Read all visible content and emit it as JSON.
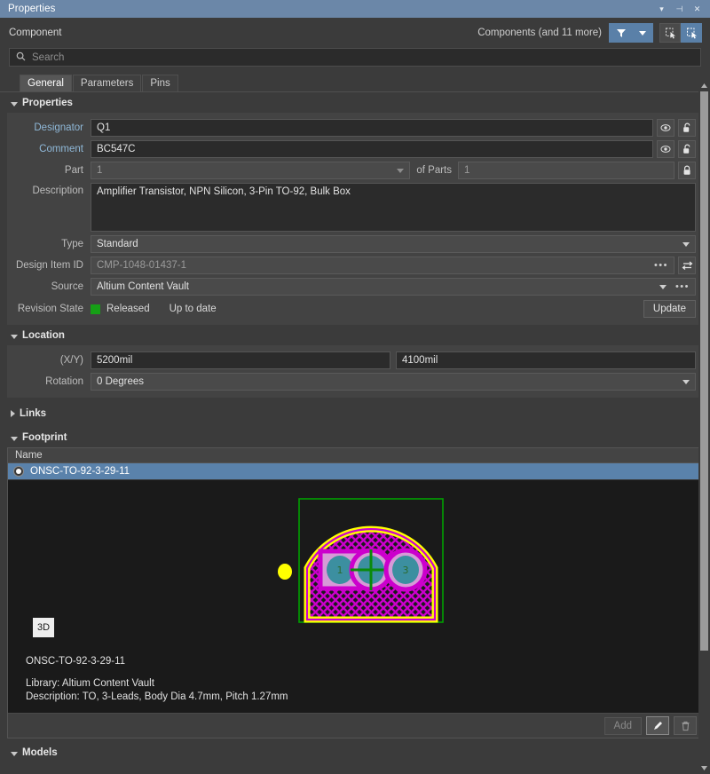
{
  "window": {
    "title": "Properties",
    "buttons": [
      {
        "name": "collapse-menu-icon",
        "glyph": "▾"
      },
      {
        "name": "dock-pin-icon",
        "glyph": "⊣"
      },
      {
        "name": "close-icon",
        "glyph": "✕"
      }
    ]
  },
  "header": {
    "object_kind": "Component",
    "selection_summary": "Components (and 11 more)",
    "filter_button": "filter-funnel-icon",
    "filter_dropdown": "filter-dropdown-caret",
    "select_mode_button": "select-touching-icon",
    "select_mode_button_active": "select-enclosed-icon"
  },
  "search": {
    "placeholder": "Search",
    "value": "",
    "icon": "search-icon"
  },
  "tabs": [
    {
      "label": "General",
      "active": true
    },
    {
      "label": "Parameters",
      "active": false
    },
    {
      "label": "Pins",
      "active": false
    }
  ],
  "sections": {
    "properties": {
      "title": "Properties",
      "expanded": true
    },
    "location": {
      "title": "Location",
      "expanded": true
    },
    "links": {
      "title": "Links",
      "expanded": false
    },
    "footprint": {
      "title": "Footprint",
      "expanded": true
    },
    "models": {
      "title": "Models",
      "expanded": true
    }
  },
  "properties": {
    "designator": {
      "label": "Designator",
      "value": "Q1",
      "visible_icon": "eye-icon",
      "lock_icon": "unlocked-padlock-icon"
    },
    "comment": {
      "label": "Comment",
      "value": "BC547C",
      "visible_icon": "eye-icon",
      "lock_icon": "unlocked-padlock-icon"
    },
    "part": {
      "label": "Part",
      "value": "1"
    },
    "of_parts": {
      "label": "of Parts",
      "value": "1",
      "lock_icon": "locked-padlock-icon"
    },
    "description": {
      "label": "Description",
      "value": "Amplifier Transistor, NPN Silicon, 3-Pin TO-92, Bulk Box"
    },
    "type": {
      "label": "Type",
      "value": "Standard"
    },
    "design_item_id": {
      "label": "Design Item ID",
      "value": "CMP-1048-01437-1",
      "more_icon": "ellipsis-icon",
      "swap_icon": "swap-arrows-icon"
    },
    "source": {
      "label": "Source",
      "value": "Altium Content Vault",
      "more_icon": "ellipsis-icon"
    },
    "revision_state": {
      "label": "Revision State",
      "state": "Released",
      "status": "Up to date",
      "state_color": "#16a016",
      "update_button": "Update"
    }
  },
  "location": {
    "xy_label": "(X/Y)",
    "x": "5200mil",
    "y": "4100mil",
    "rotation_label": "Rotation",
    "rotation": "0 Degrees"
  },
  "footprint": {
    "column_header": "Name",
    "rows": [
      {
        "name": "ONSC-TO-92-3-29-11",
        "selected": true
      }
    ],
    "preview": {
      "view_toggle": "3D",
      "name": "ONSC-TO-92-3-29-11",
      "library": "Library: Altium Content Vault",
      "description": "Description: TO, 3-Leads, Body Dia 4.7mm, Pitch 1.27mm",
      "colors": {
        "background": "#1a1a1a",
        "silkscreen": "#ffff00",
        "pad": "#cc00cc",
        "hole": "#3c8fa0",
        "courtyard": "#00a000"
      },
      "pads": [
        "1",
        "2",
        "3"
      ]
    },
    "actions": {
      "add_label": "Add",
      "edit_icon": "pencil-edit-icon",
      "delete_icon": "trash-delete-icon"
    }
  }
}
